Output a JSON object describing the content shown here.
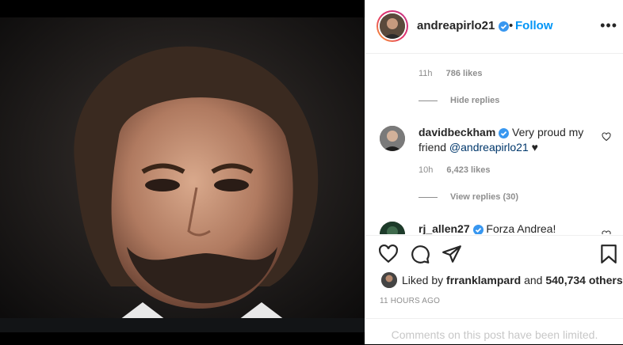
{
  "post": {
    "owner": "andreapirlo21",
    "follow_label": "Follow",
    "dot": "•",
    "more_label": "•••"
  },
  "comments": {
    "first": {
      "time": "11h",
      "likes": "786 likes",
      "replies_label": "Hide replies"
    },
    "second": {
      "user": "davidbeckham",
      "text_before": " Very proud my friend ",
      "mention": "@andreapirlo21",
      "text_after": " ♥",
      "time": "10h",
      "likes": "6,423 likes",
      "replies_label": "View replies (30)"
    },
    "third": {
      "user": "rj_allen27",
      "text": " Forza Andrea!"
    }
  },
  "actions": {
    "liked_by_prefix": "Liked by ",
    "liked_by_user": "frranklampard",
    "liked_by_and": " and ",
    "likes_count": "540,734 others",
    "timestamp": "11 HOURS AGO",
    "comments_limited": "Comments on this post have been limited."
  },
  "colors": {
    "accent": "#0095f6",
    "verified": "#3897f0",
    "text": "#262626",
    "muted": "#8e8e8e"
  },
  "icons": [
    "more-icon",
    "verified-icon",
    "heart-icon",
    "comment-icon",
    "share-icon",
    "bookmark-icon"
  ]
}
